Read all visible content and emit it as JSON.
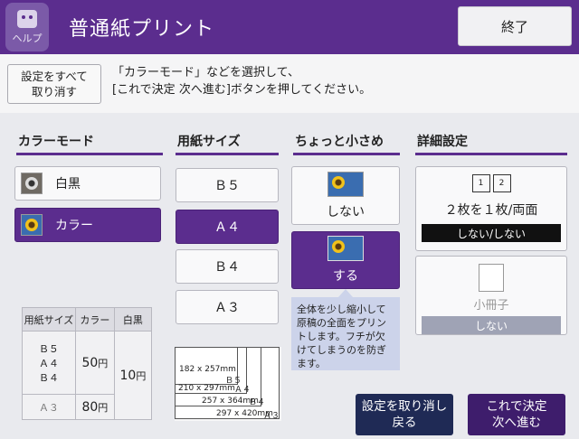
{
  "header": {
    "help_label": "ヘルプ",
    "title": "普通紙プリント",
    "end_label": "終了"
  },
  "toolbar": {
    "cancel_all_line1": "設定をすべて",
    "cancel_all_line2": "取り消す",
    "message_line1": "「カラーモード」などを選択して、",
    "message_line2": "[これで決定 次へ進む]ボタンを押してください。"
  },
  "color_mode": {
    "heading": "カラーモード",
    "options": [
      {
        "label": "白黒",
        "selected": false
      },
      {
        "label": "カラー",
        "selected": true
      }
    ]
  },
  "paper_size": {
    "heading": "用紙サイズ",
    "options": [
      {
        "label": "Ｂ５",
        "selected": false
      },
      {
        "label": "Ａ４",
        "selected": true
      },
      {
        "label": "Ｂ４",
        "selected": false
      },
      {
        "label": "Ａ３",
        "selected": false
      }
    ]
  },
  "reduce": {
    "heading": "ちょっと小さめ",
    "off_label": "しない",
    "on_label": "する",
    "on_selected": true,
    "tip": "全体を少し縮小して原稿の全面をプリントします。フチが欠けてしまうのを防ぎます。"
  },
  "details": {
    "heading": "詳細設定",
    "nup_label": "２枚を１枚/両面",
    "nup_value": "しない/しない",
    "booklet_label": "小冊子",
    "booklet_value": "しない"
  },
  "price_table": {
    "headers": [
      "用紙サイズ",
      "カラー",
      "白黒"
    ],
    "row1_sizes": [
      "Ｂ５",
      "Ａ４",
      "Ｂ４"
    ],
    "row1_color": "50",
    "bw_price": "10",
    "row2_size": "Ａ３",
    "row2_color": "80",
    "unit": "円"
  },
  "paper_diagram": [
    {
      "dims": "182 x 257mm",
      "size": "Ｂ５"
    },
    {
      "dims": "210 x 297mm",
      "size": "Ａ４"
    },
    {
      "dims": "257 x 364mm",
      "size": "Ｂ４"
    },
    {
      "dims": "297 x 420mm",
      "size": "Ａ３"
    }
  ],
  "footer": {
    "undo_line1": "設定を取り消し",
    "undo_line2": "戻る",
    "confirm_line1": "これで決定",
    "confirm_line2": "次へ進む"
  },
  "colors": {
    "accent": "#5b2d8e",
    "tip_bg": "#ccd3ea",
    "background": "#e9eaee"
  }
}
